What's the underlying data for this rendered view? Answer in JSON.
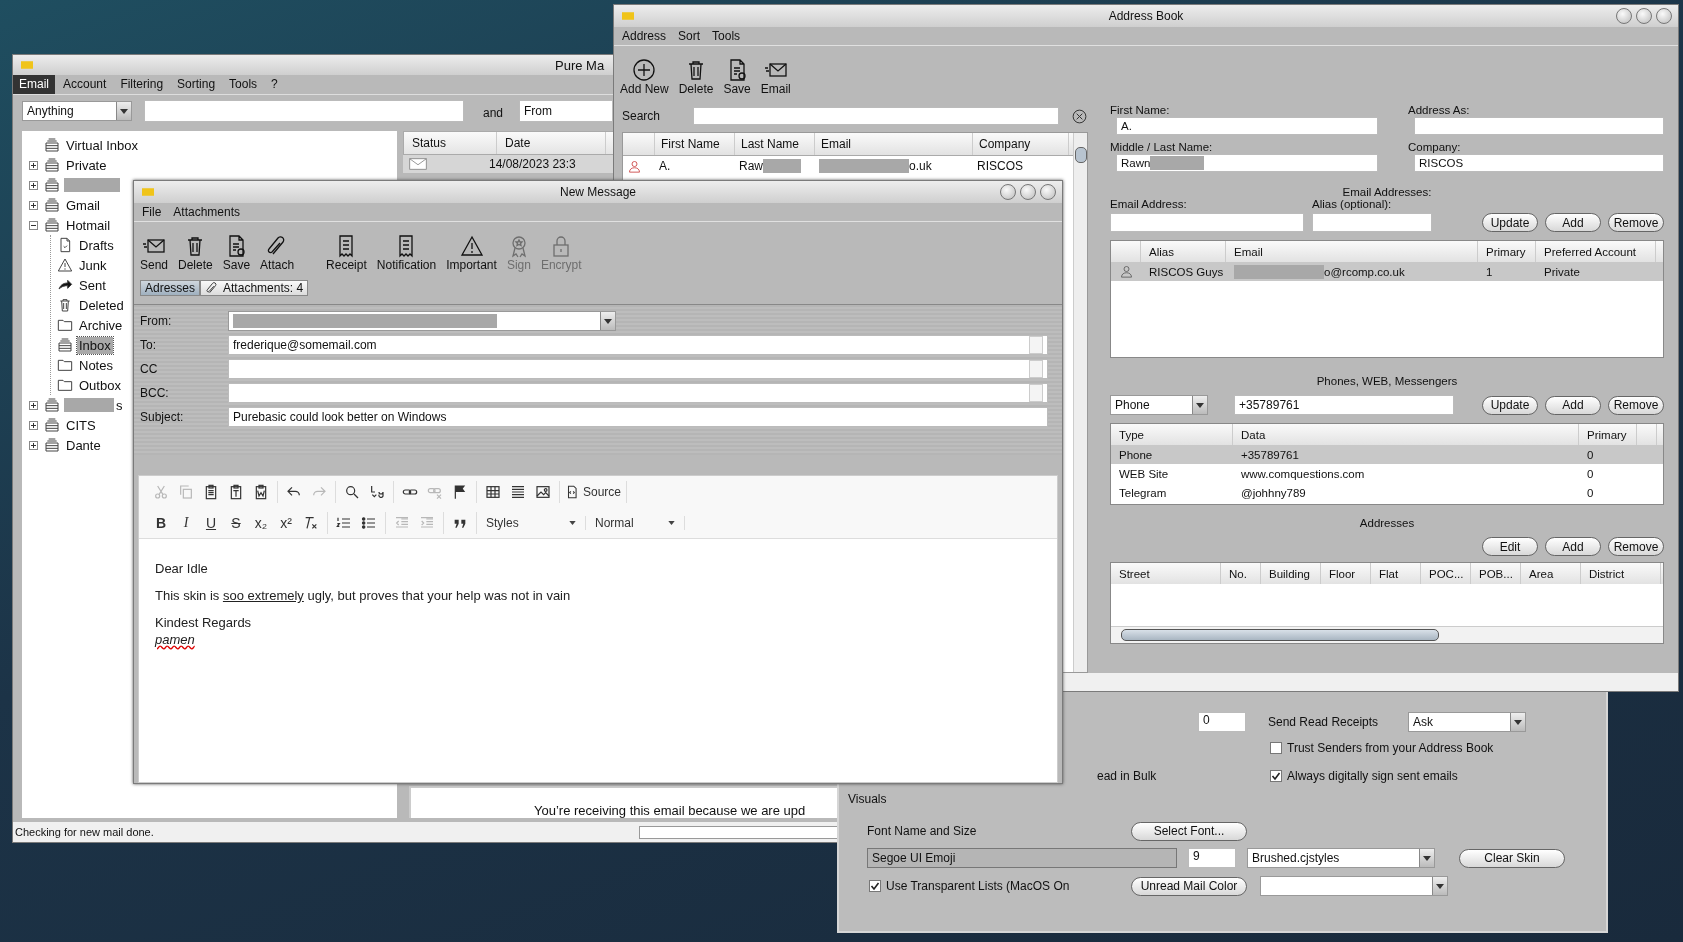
{
  "main_window": {
    "title": "Pure Ma",
    "menu": [
      {
        "label": "Email",
        "selected": true
      },
      {
        "label": "Account",
        "selected": false
      },
      {
        "label": "Filtering",
        "selected": false
      },
      {
        "label": "Sorting",
        "selected": false
      },
      {
        "label": "Tools",
        "selected": false
      },
      {
        "label": "?",
        "selected": false
      }
    ],
    "search": {
      "scope": "Anything",
      "joiner": "and",
      "field": "From"
    },
    "folders": [
      {
        "label": "Virtual Inbox",
        "kind": "tray",
        "selected": false
      },
      {
        "label": "Private",
        "kind": "tray",
        "expanded": false,
        "selected": false
      },
      {
        "kind": "tray",
        "redacted": true,
        "expanded": false,
        "selected": false
      },
      {
        "label": "Gmail",
        "kind": "tray",
        "expanded": false,
        "selected": false
      },
      {
        "label": "Hotmail",
        "kind": "tray",
        "expanded": true,
        "selected": false,
        "children": [
          {
            "label": "Drafts",
            "kind": "page",
            "selected": false
          },
          {
            "label": "Junk",
            "kind": "warning",
            "selected": false
          },
          {
            "label": "Sent",
            "kind": "arrow",
            "selected": false
          },
          {
            "label": "Deleted",
            "kind": "trash",
            "selected": false
          },
          {
            "label": "Archive",
            "kind": "folder",
            "selected": false
          },
          {
            "label": "Inbox",
            "kind": "tray",
            "selected": true
          },
          {
            "label": "Notes",
            "kind": "folder",
            "selected": false
          },
          {
            "label": "Outbox",
            "kind": "folder",
            "selected": false
          }
        ]
      },
      {
        "label": "s",
        "kind": "tray",
        "redacted": true,
        "expanded": false,
        "selected": false
      },
      {
        "label": "CITS",
        "kind": "tray",
        "expanded": false,
        "selected": false
      },
      {
        "label": "Dante",
        "kind": "tray",
        "expanded": false,
        "selected": false
      }
    ],
    "message_columns": [
      "Status",
      "Date"
    ],
    "messages": [
      {
        "date": "14/08/2023 23:3"
      }
    ],
    "preview": "You’re receiving this email because we are upd",
    "status": "Checking for new mail done.",
    "progress": {
      "level": 0
    }
  },
  "new_message": {
    "title": "New Message",
    "menu": [
      "File",
      "Attachments"
    ],
    "toolbar": [
      {
        "label": "Send",
        "disabled": false
      },
      {
        "label": "Delete",
        "disabled": false
      },
      {
        "label": "Save",
        "disabled": false
      },
      {
        "label": "Attach",
        "disabled": false
      },
      {
        "label": "Receipt",
        "disabled": false
      },
      {
        "label": "Notification",
        "disabled": false
      },
      {
        "label": "Important",
        "disabled": false
      },
      {
        "label": "Sign",
        "disabled": true
      },
      {
        "label": "Encrypt",
        "disabled": true
      }
    ],
    "tabs": [
      {
        "label": "Adresses",
        "selected": true
      },
      {
        "label": "Attachments: 4",
        "selected": false
      }
    ],
    "fields": [
      {
        "label": "From:",
        "kind": "dropdown",
        "redacted": true
      },
      {
        "label": "To:",
        "kind": "recipients",
        "value": "frederique@somemail.com"
      },
      {
        "label": "CC",
        "kind": "recipients"
      },
      {
        "label": "BCC:",
        "kind": "recipients"
      },
      {
        "label": "Subject:",
        "kind": "text",
        "value": "Purebasic could look better on Windows"
      }
    ],
    "editor_toolbar": [
      [
        [
          {
            "kind": "icon",
            "disabled": true
          },
          {
            "kind": "icon",
            "disabled": true
          },
          {
            "kind": "icon",
            "disabled": false
          },
          {
            "kind": "icon",
            "disabled": false
          },
          {
            "kind": "icon",
            "disabled": false
          }
        ],
        [
          {
            "kind": "icon",
            "disabled": false
          },
          {
            "kind": "icon",
            "disabled": true
          }
        ],
        [
          {
            "kind": "icon",
            "disabled": false
          },
          {
            "kind": "icon",
            "disabled": false
          }
        ],
        [
          {
            "kind": "icon",
            "disabled": false
          },
          {
            "kind": "icon",
            "disabled": true
          },
          {
            "kind": "icon",
            "disabled": false
          }
        ],
        [
          {
            "kind": "icon",
            "disabled": false
          },
          {
            "kind": "icon",
            "disabled": false
          },
          {
            "kind": "icon",
            "disabled": false
          }
        ],
        [
          {
            "kind": "button",
            "label": "Source",
            "disabled": false
          }
        ]
      ],
      [
        [
          {
            "kind": "letter",
            "label": "B",
            "disabled": false
          },
          {
            "kind": "letter",
            "label": "I",
            "disabled": false
          },
          {
            "kind": "letter",
            "label": "U",
            "disabled": false
          },
          {
            "kind": "letter",
            "label": "S",
            "disabled": false
          },
          {
            "kind": "letter",
            "label": "x₂",
            "disabled": false
          },
          {
            "kind": "letter",
            "label": "x²",
            "disabled": false
          },
          {
            "kind": "icon",
            "disabled": false
          }
        ],
        [
          {
            "kind": "icon",
            "disabled": false
          },
          {
            "kind": "icon",
            "disabled": false
          }
        ],
        [
          {
            "kind": "icon",
            "disabled": true
          },
          {
            "kind": "icon",
            "disabled": true
          }
        ],
        [
          {
            "kind": "icon",
            "disabled": false
          }
        ],
        [
          {
            "kind": "dropdown",
            "label": "Styles",
            "disabled": false
          }
        ],
        [
          {
            "kind": "dropdown",
            "label": "Normal",
            "disabled": false
          }
        ]
      ]
    ],
    "body": [
      {
        "kind": "paragraph",
        "parts": [
          {
            "text": "Dear Idle"
          }
        ]
      },
      {
        "kind": "paragraph",
        "parts": [
          {
            "text": "This skin is "
          },
          {
            "text": "soo extremely",
            "underline": true
          },
          {
            "text": " ugly, but proves that your help was not in vain"
          }
        ]
      },
      {
        "kind": "paragraph",
        "parts": [
          {
            "text": "Kindest Regards"
          }
        ]
      },
      {
        "kind": "line",
        "parts": [
          {
            "text": "pamen",
            "italic": true,
            "misspelled": true
          }
        ]
      }
    ]
  },
  "address_book": {
    "title": "Address Book",
    "menu": [
      "Address",
      "Sort",
      "Tools"
    ],
    "toolbar": [
      "Add New",
      "Delete",
      "Save",
      "Email"
    ],
    "search_label": "Search",
    "contact_columns": [
      "First Name",
      "Last Name",
      "Email",
      "Company"
    ],
    "contacts": [
      {
        "selected": false,
        "cells": [
          {
            "text": "A."
          },
          {
            "text": "Raw",
            "redacted": true
          },
          {
            "text": "o.uk",
            "redacted": true
          },
          {
            "text": "RISCOS"
          }
        ]
      }
    ],
    "name_fields": [
      {
        "label": "First Name:",
        "value": "A."
      },
      {
        "label": "Address As:"
      },
      {
        "label": "Middle / Last Name:",
        "value": "Rawn",
        "redacted": true
      },
      {
        "label": "Company:",
        "value": "RISCOS"
      }
    ],
    "email_heading": "Email Addresses:",
    "email_label": "Email Address:",
    "alias_label": "Alias (optional):",
    "email_buttons": [
      "Update",
      "Add",
      "Remove"
    ],
    "email_columns": [
      "Alias",
      "Email",
      "Primary",
      "Preferred Account"
    ],
    "emails": [
      {
        "selected": true,
        "cells": [
          {
            "text": "RISCOS Guys"
          },
          {
            "text": "o@rcomp.co.uk",
            "redacted": true
          },
          {
            "text": "1"
          },
          {
            "text": "Private"
          }
        ]
      }
    ],
    "phones_heading": "Phones, WEB, Messengers",
    "phone_type": "Phone",
    "phone_value": "+35789761",
    "phone_buttons": [
      "Update",
      "Add",
      "Remove"
    ],
    "phone_columns": [
      "Type",
      "Data",
      "Primary"
    ],
    "phones": [
      {
        "selected": true,
        "cells": [
          "Phone",
          "+35789761",
          "0"
        ]
      },
      {
        "selected": false,
        "cells": [
          "WEB Site",
          "www.comquestions.com",
          "0"
        ]
      },
      {
        "selected": false,
        "cells": [
          "Telegram",
          "@johhny789",
          "0"
        ]
      }
    ],
    "addresses_heading": "Addresses",
    "address_buttons": [
      "Edit",
      "Add",
      "Remove"
    ],
    "address_columns": [
      "Street",
      "No.",
      "Building",
      "Floor",
      "Flat",
      "POC...",
      "POB...",
      "Area",
      "District"
    ]
  },
  "settings": {
    "counter": "0",
    "receipts_label": "Send Read Receipts",
    "receipts": "Ask",
    "checkboxes": [
      {
        "label": "Trust Senders from your Address Book",
        "checked": false
      },
      {
        "label": "Always digitally sign sent emails",
        "checked": true
      }
    ],
    "bulk_fragment": "ead in Bulk",
    "visuals": "Visuals",
    "font_label": "Font Name and Size",
    "select_font": "Select Font...",
    "font_name": "Segoe UI Emoji",
    "font_size": "9",
    "skin": "Brushed.cjstyles",
    "clear_skin": "Clear Skin",
    "transparent": {
      "label": "Use Transparent Lists (MacOS On",
      "checked": true
    },
    "unread_color": "Unread Mail Color"
  }
}
